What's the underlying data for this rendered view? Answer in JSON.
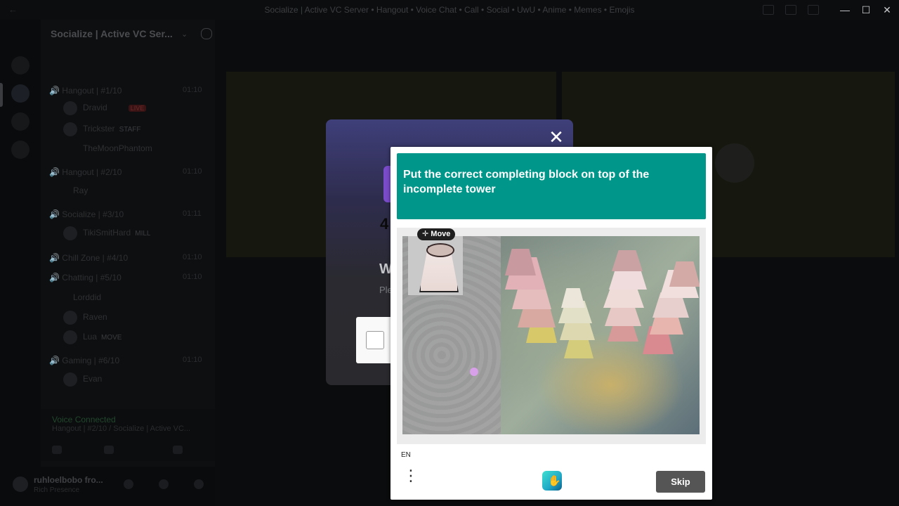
{
  "window": {
    "title": "Socialize | Active VC Server • Hangout • Voice Chat • Call • Social • UwU • Anime • Memes • Emojis",
    "minimize": "—",
    "maximize": "☐",
    "close": "✕"
  },
  "sidebar": {
    "server_name": "Socialize | Active VC Ser...",
    "channels": [
      {
        "label": "Hangout | #1/10",
        "count": "01:10"
      },
      {
        "label": "Hangout | #2/10",
        "count": "01:10"
      },
      {
        "label": "Socialize | #3/10",
        "count": "01:11"
      },
      {
        "label": "Chill Zone | #4/10",
        "count": "01:10"
      },
      {
        "label": "Chatting | #5/10",
        "count": "01:10"
      },
      {
        "label": "Gaming | #6/10",
        "count": "01:10"
      }
    ],
    "members": [
      {
        "name": "Dravid",
        "badge": "LIVE"
      },
      {
        "name": "Trickster",
        "tag": "STAFF"
      },
      {
        "name": "TheMoonPhantom"
      },
      {
        "name": "Ray"
      },
      {
        "name": "TikiSmitHard",
        "tag": "MILL"
      },
      {
        "name": "Lorddid"
      },
      {
        "name": "Raven"
      },
      {
        "name": "Lua",
        "tag": "MOVE"
      },
      {
        "name": "Evan"
      }
    ],
    "voice_status": "Voice Connected",
    "voice_sub": "Hangout | #2/10 / Socialize | Active VC...",
    "user": {
      "name": "ruhloelbobo fro...",
      "status": "Rich Presence"
    }
  },
  "background_modal": {
    "close": "✕",
    "heading": "W",
    "subtext": "Ple",
    "glyph": "4"
  },
  "challenge": {
    "prompt": "Put the correct completing block on top of the incomplete tower",
    "move_label": "Move",
    "move_icon": "move-cross-icon",
    "language": "EN",
    "menu_icon": "⋮",
    "logo_icon": "hcaptcha-logo-icon",
    "skip_label": "Skip"
  },
  "colors": {
    "prompt_bg": "#00968a",
    "skip_bg": "#555555",
    "drop_dot": "#d8a0e8"
  }
}
